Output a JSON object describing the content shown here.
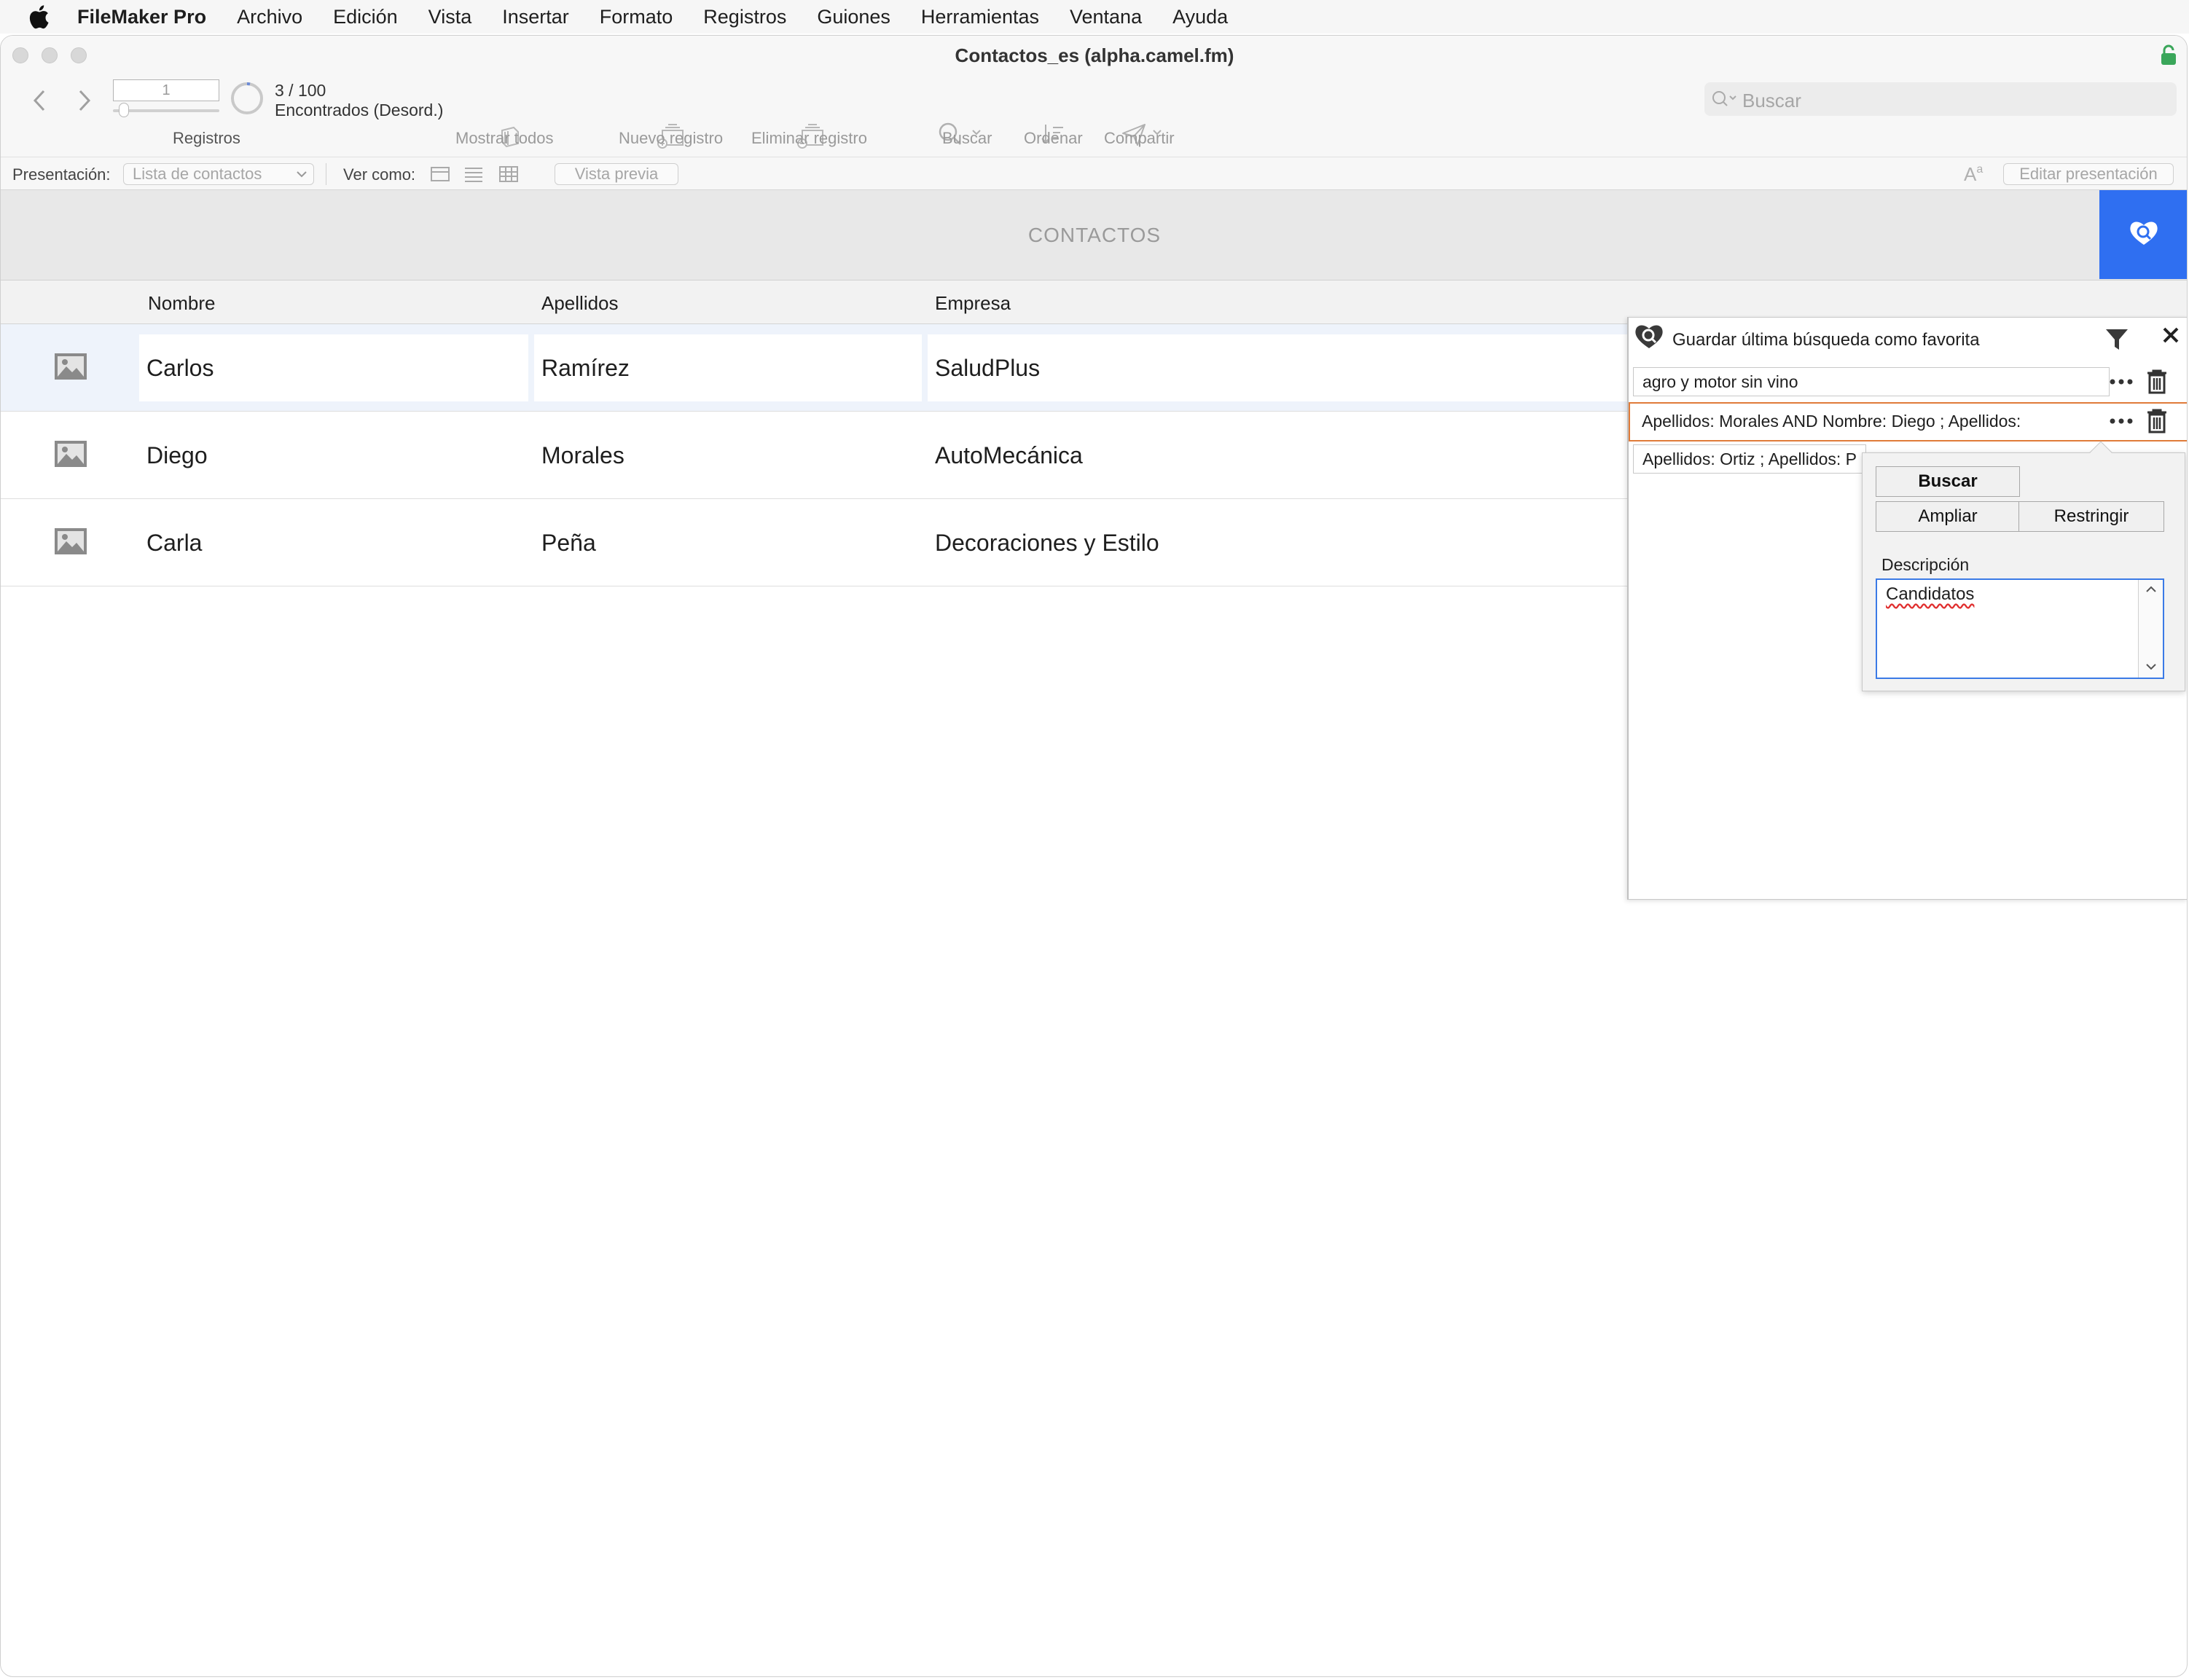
{
  "menubar": {
    "app": "FileMaker Pro",
    "items": [
      "Archivo",
      "Edición",
      "Vista",
      "Insertar",
      "Formato",
      "Registros",
      "Guiones",
      "Herramientas",
      "Ventana",
      "Ayuda"
    ]
  },
  "window": {
    "title": "Contactos_es (alpha.camel.fm)"
  },
  "toolbar": {
    "record_number": "1",
    "found_count": "3 / 100",
    "found_state": "Encontrados (Desord.)",
    "records_label": "Registros",
    "show_all": "Mostrar todos",
    "new_record": "Nuevo registro",
    "delete_record": "Eliminar registro",
    "find": "Buscar",
    "sort": "Ordenar",
    "share": "Compartir",
    "search_placeholder": "Buscar"
  },
  "statusbar": {
    "layout_label": "Presentación:",
    "layout_value": "Lista de contactos",
    "view_as": "Ver como:",
    "preview": "Vista previa",
    "edit_layout": "Editar presentación"
  },
  "layout": {
    "header_title": "CONTACTOS",
    "columns": [
      "Nombre",
      "Apellidos",
      "Empresa"
    ],
    "rows": [
      {
        "nombre": "Carlos",
        "apellidos": "Ramírez",
        "empresa": "SaludPlus"
      },
      {
        "nombre": "Diego",
        "apellidos": "Morales",
        "empresa": "AutoMecánica"
      },
      {
        "nombre": "Carla",
        "apellidos": "Peña",
        "empresa": "Decoraciones y Estilo"
      }
    ]
  },
  "favorites_panel": {
    "title": "Guardar última búsqueda como favorita",
    "items": [
      "agro y motor sin vino",
      "Apellidos: Morales AND Nombre: Diego ; Apellidos:",
      "Apellidos: Ortiz ; Apellidos: P"
    ],
    "popover": {
      "find": "Buscar",
      "extend": "Ampliar",
      "constrain": "Restringir",
      "description_label": "Descripción",
      "description_value": "Candidatos"
    }
  },
  "colors": {
    "accent": "#2f6ff1",
    "selected_outline": "#e07b39",
    "row_selected": "#eef3fb"
  }
}
